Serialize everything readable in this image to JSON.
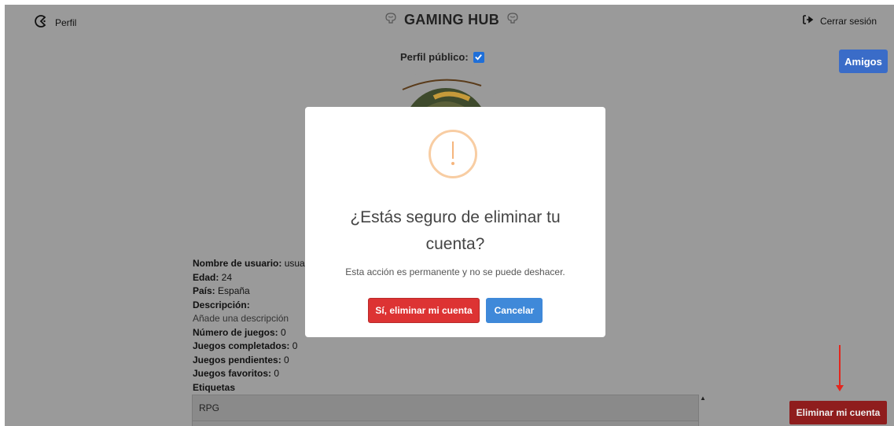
{
  "header": {
    "profile_label": "Perfil",
    "brand": "GAMING HUB",
    "logout_label": "Cerrar sesión"
  },
  "profile": {
    "public_label": "Perfil público:",
    "public_checked": true,
    "friends_label": "Amigos",
    "fields": [
      {
        "key": "Nombre de usuario:",
        "value": " usua"
      },
      {
        "key": "Edad:",
        "value": " 24"
      },
      {
        "key": "País:",
        "value": " España"
      },
      {
        "key": "Descripción:",
        "value": ""
      },
      {
        "key": "",
        "value": "Añade una descripción"
      },
      {
        "key": "Número de juegos:",
        "value": " 0"
      },
      {
        "key": "Juegos completados:",
        "value": " 0"
      },
      {
        "key": "Juegos pendientes:",
        "value": " 0"
      },
      {
        "key": "Juegos favoritos:",
        "value": " 0"
      },
      {
        "key": "Etiquetas",
        "value": ""
      }
    ],
    "tags": [
      "RPG"
    ],
    "delete_label": "Eliminar mi cuenta"
  },
  "modal": {
    "title": "¿Estás seguro de eliminar tu cuenta?",
    "message": "Esta acción es permanente y no se puede deshacer.",
    "confirm_label": "Sí, eliminar mi cuenta",
    "cancel_label": "Cancelar"
  },
  "colors": {
    "overlay_bg": "#9a9a9a",
    "confirm": "#dd3333",
    "cancel": "#3f89d9",
    "friends": "#3a6cc8",
    "delete": "#8f1d1d",
    "warning": "#f8cda3",
    "arrow": "#e3261e"
  }
}
